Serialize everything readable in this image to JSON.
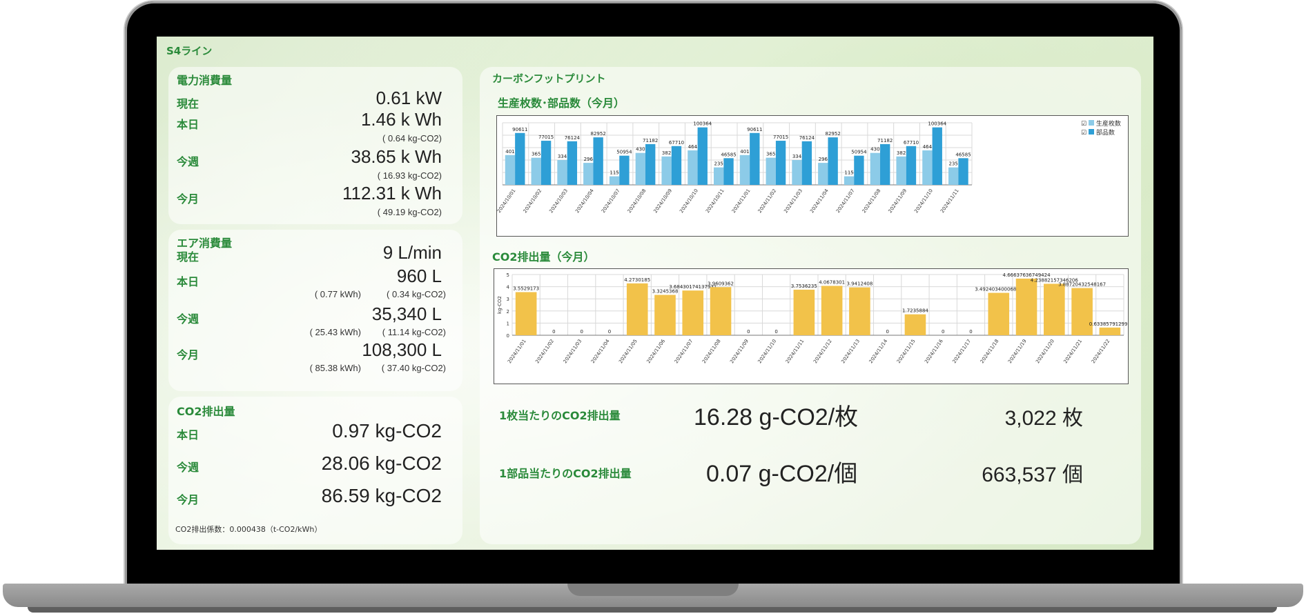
{
  "page_title": "S4ライン",
  "power": {
    "title": "電力消費量",
    "rows": [
      {
        "label": "現在",
        "value": "0.61 kW",
        "sub": ""
      },
      {
        "label": "本日",
        "value": "1.46  k Wh",
        "sub": "( 0.64 kg-CO2)"
      },
      {
        "label": "今週",
        "value": "38.65  k Wh",
        "sub": "( 16.93 kg-CO2)"
      },
      {
        "label": "今月",
        "value": "112.31  k Wh",
        "sub": "( 49.19 kg-CO2)"
      }
    ]
  },
  "air": {
    "title": "エア消費量",
    "rows": [
      {
        "label": "現在",
        "value": "9 L/min",
        "sub1": "",
        "sub2": ""
      },
      {
        "label": "本日",
        "value": "960 L",
        "sub1": "( 0.77 kWh)",
        "sub2": "( 0.34 kg-CO2)"
      },
      {
        "label": "今週",
        "value": "35,340 L",
        "sub1": "( 25.43 kWh)",
        "sub2": "( 11.14 kg-CO2)"
      },
      {
        "label": "今月",
        "value": "108,300 L",
        "sub1": "( 85.38 kWh)",
        "sub2": "( 37.40 kg-CO2)"
      }
    ]
  },
  "co2": {
    "title": "CO2排出量",
    "rows": [
      {
        "label": "本日",
        "value": "0.97 kg-CO2"
      },
      {
        "label": "今週",
        "value": "28.06 kg-CO2"
      },
      {
        "label": "今月",
        "value": "86.59 kg-CO2"
      }
    ],
    "coefficient": "CO2排出係数：0.000438（t-CO2/kWh）"
  },
  "carbon": {
    "title": "カーボンフットプリント",
    "production_chart_title": "生産枚数･部品数（今月）",
    "co2_chart_title": "CO2排出量（今月）",
    "per_sheet_label": "1枚当たりのCO2排出量",
    "per_sheet_value": "16.28 g-CO2/枚",
    "sheet_count": "3,022 枚",
    "per_part_label": "1部品当たりのCO2排出量",
    "per_part_value": "0.07 g-CO2/個",
    "part_count": "663,537 個"
  },
  "colors": {
    "accent_green": "#2a8a3a",
    "series_light": "#8ccbe8",
    "series_dark": "#2e9fd6",
    "co2_bar": "#f2c24a"
  },
  "chart_data": [
    {
      "type": "bar",
      "title": "",
      "categories": [
        "2024/10/01",
        "2024/10/02",
        "2024/10/03",
        "2024/10/04",
        "2024/10/07",
        "2024/10/08",
        "2024/10/09",
        "2024/10/10",
        "2024/10/11",
        "2024/11/01",
        "2024/11/02",
        "2024/11/03",
        "2024/11/04",
        "2024/11/07",
        "2024/11/08",
        "2024/11/09",
        "2024/11/10",
        "2024/11/11"
      ],
      "series": [
        {
          "name": "生産枚数",
          "values": [
            401,
            365,
            334,
            296,
            115,
            430,
            382,
            464,
            235,
            401,
            365,
            334,
            296,
            115,
            430,
            382,
            464,
            235
          ]
        },
        {
          "name": "部品数",
          "values": [
            90611,
            77015,
            76124,
            82952,
            50954,
            71182,
            67710,
            100364,
            46585,
            90611,
            77015,
            76124,
            82952,
            50954,
            71182,
            67710,
            100364,
            46585
          ]
        }
      ],
      "legend_position": "right"
    },
    {
      "type": "bar",
      "title": "",
      "ylabel": "kg-CO2",
      "ylim": [
        0,
        5
      ],
      "yticks": [
        0,
        1,
        2,
        3,
        4,
        5
      ],
      "categories": [
        "2024/11/01",
        "2024/11/02",
        "2024/11/03",
        "2024/11/04",
        "2024/11/05",
        "2024/11/06",
        "2024/11/07",
        "2024/11/08",
        "2024/11/09",
        "2024/11/10",
        "2024/11/11",
        "2024/11/12",
        "2024/11/13",
        "2024/11/14",
        "2024/11/15",
        "2024/11/16",
        "2024/11/17",
        "2024/11/18",
        "2024/11/19",
        "2024/11/20",
        "2024/11/21",
        "2024/11/22"
      ],
      "values": [
        3.5529173,
        0,
        0,
        0,
        4.2730185,
        3.3245368,
        3.68430174137931,
        3.9609362,
        0,
        0,
        3.7536235,
        4.0678301,
        3.9412408,
        0,
        1.7235884,
        0,
        0,
        3.49240340006829,
        4.66637636749424,
        4.23882157346206,
        3.88720432548167,
        0.633857912999
      ],
      "value_labels": [
        "3.5529173",
        "0",
        "0",
        "0",
        "4.2730185",
        "3.3245368",
        "3.68430174137931",
        "3.9609362",
        "0",
        "0",
        "3.7536235",
        "4.0678301",
        "3.9412408",
        "0",
        "1.7235884",
        "0",
        "0",
        "3.49240340006829",
        "4.66637636749424",
        "4.23882157346206",
        "3.88720432548167",
        "0.633857912999"
      ]
    }
  ]
}
